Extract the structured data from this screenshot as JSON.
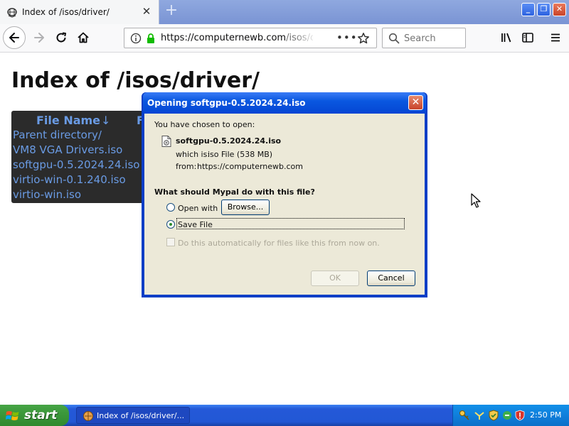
{
  "browser": {
    "tab": {
      "title": "Index of /isos/driver/"
    },
    "url": {
      "host": "https://computernewb.com",
      "path": "/isos/driv"
    },
    "search": {
      "placeholder": "Search"
    }
  },
  "page": {
    "heading": "Index of /isos/driver/",
    "table": {
      "columns": [
        "File Name",
        "↓",
        "F"
      ],
      "rows": [
        "Parent directory/",
        "VM8 VGA Drivers.iso",
        "softgpu-0.5.2024.24.iso",
        "virtio-win-0.1.240.iso",
        "virtio-win.iso"
      ]
    }
  },
  "dialog": {
    "title": "Opening softgpu-0.5.2024.24.iso",
    "close_label": "✕",
    "intro": "You have chosen to open:",
    "filename": "softgpu-0.5.2024.24.iso",
    "which_is_label": "which is:",
    "which_is_value": "iso File (538 MB)",
    "from_label": "from:",
    "from_value": "https://computernewb.com",
    "question": "What should Mypal do with this file?",
    "open_with_label": "Open with",
    "browse_label": "Browse...",
    "save_file_label": "Save File",
    "auto_label": "Do this automatically for files like this from now on.",
    "ok_label": "OK",
    "cancel_label": "Cancel",
    "selected_option": "save_file"
  },
  "taskbar": {
    "start_label": "start",
    "task_label": "Index of /isos/driver/...",
    "clock": "2:50 PM"
  },
  "icons": {
    "tab_favicon": "server-icon",
    "new_tab": "plus-icon",
    "back": "back-arrow-icon",
    "forward": "forward-arrow-icon",
    "reload": "reload-icon",
    "home": "home-icon",
    "site_info": "info-icon",
    "secure": "lock-icon",
    "page_actions": "ellipsis-icon",
    "bookmark": "star-icon",
    "search": "magnifier-icon",
    "library": "library-icon",
    "sidebars": "sidebar-icon",
    "menu": "hamburger-icon"
  },
  "colors": {
    "xp_blue": "#0a3ec6",
    "dialog_bg": "#ece9d8",
    "link_blue": "#6a9be4",
    "listing_bg": "#2b2b2b",
    "start_green": "#3c983b",
    "lock_green": "#12bc00"
  }
}
